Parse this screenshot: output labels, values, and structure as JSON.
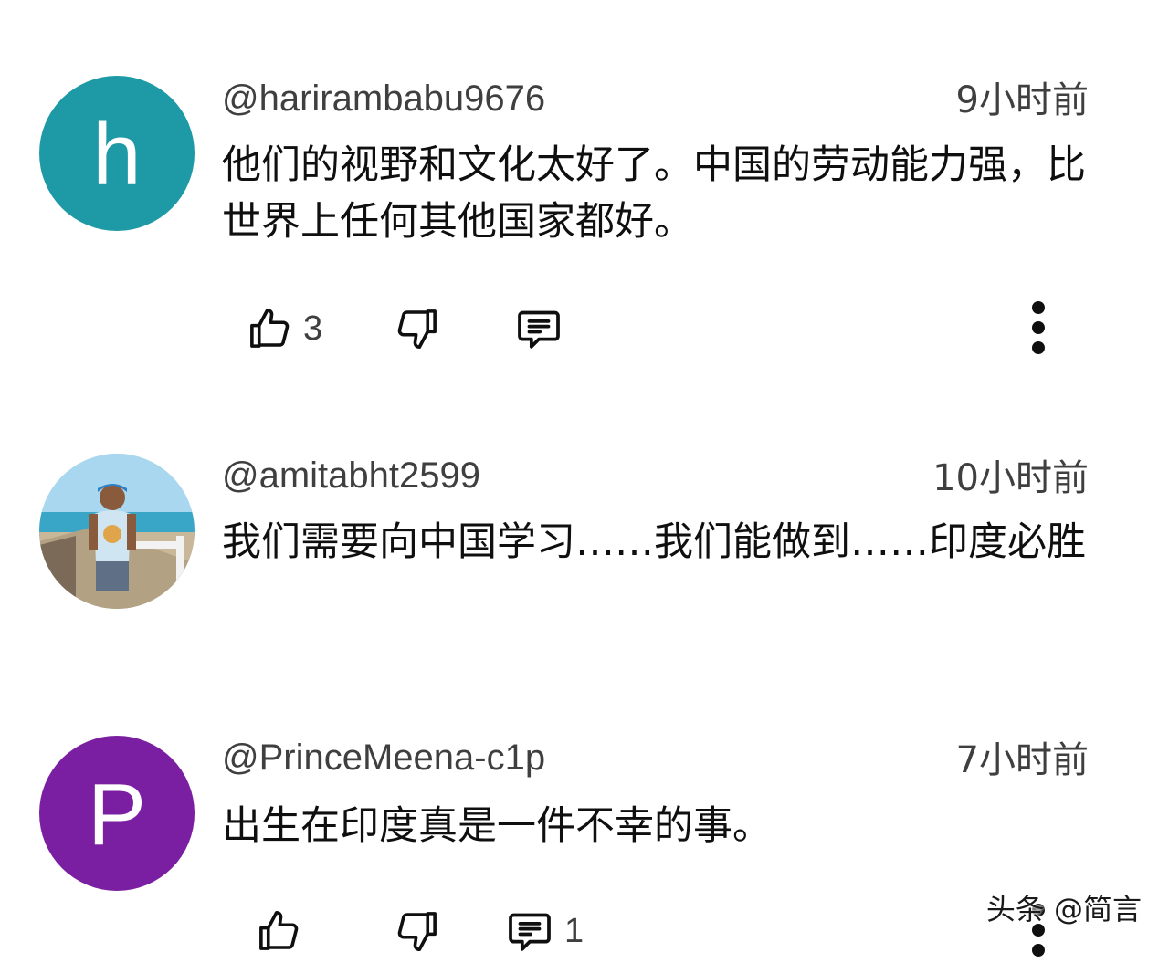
{
  "comments": [
    {
      "handle": "@harirambabu9676",
      "time": "9小时前",
      "text": "他们的视野和文化太好了。中国的劳动能力强，比世界上任何其他国家都好。",
      "avatar_letter": "h",
      "avatar_color": "#1e9aa6",
      "likes": "3",
      "replies": ""
    },
    {
      "handle": "@amitabht2599",
      "time": "10小时前",
      "text": "我们需要向中国学习……我们能做到……印度必胜",
      "avatar_letter": "",
      "avatar_color": "#8fc6e0",
      "likes": "",
      "replies": ""
    },
    {
      "handle": "@PrinceMeena-c1p",
      "time": "7小时前",
      "text": "出生在印度真是一件不幸的事。",
      "avatar_letter": "P",
      "avatar_color": "#7b1fa2",
      "likes": "",
      "replies": "1"
    }
  ],
  "watermark": "头条 @简言",
  "icons": {
    "like": "thumb-up-icon",
    "dislike": "thumb-down-icon",
    "reply": "comment-icon",
    "more": "more-vert-icon"
  }
}
